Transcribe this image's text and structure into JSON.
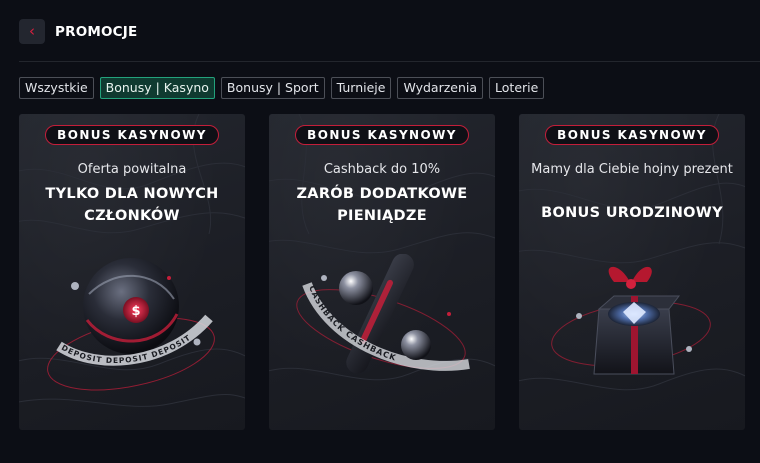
{
  "header": {
    "back_icon": "chevron-left-icon",
    "title": "PROMOCJE"
  },
  "tabs": [
    {
      "label": "Wszystkie",
      "active": false
    },
    {
      "label": "Bonusy | Kasyno",
      "active": true
    },
    {
      "label": "Bonusy | Sport",
      "active": false
    },
    {
      "label": "Turnieje",
      "active": false
    },
    {
      "label": "Wydarzenia",
      "active": false
    },
    {
      "label": "Loterie",
      "active": false
    }
  ],
  "cards": [
    {
      "badge": "BONUS KASYNOWY",
      "subtitle": "Oferta powitalna",
      "headline": "TYLKO DLA NOWYCH CZŁONKÓW",
      "art": {
        "icon": "sphere-deposit-icon",
        "ring_text": "DEPOSIT DEPOSIT DEPOSIT",
        "center_glyph": "$"
      }
    },
    {
      "badge": "BONUS KASYNOWY",
      "subtitle": "Cashback do 10%",
      "headline": "ZARÓB DODATKOWE PIENIĄDZE",
      "art": {
        "icon": "cashback-rings-icon",
        "ring_text": "CASHBACK CASHBACK"
      }
    },
    {
      "badge": "BONUS KASYNOWY",
      "subtitle": "Mamy dla Ciebie hojny prezent",
      "headline": "BONUS URODZINOWY",
      "art": {
        "icon": "gift-box-diamond-icon"
      }
    }
  ],
  "colors": {
    "accent_red": "#c41e3a",
    "active_tab": "#23a27c",
    "background": "#0c0e15"
  }
}
